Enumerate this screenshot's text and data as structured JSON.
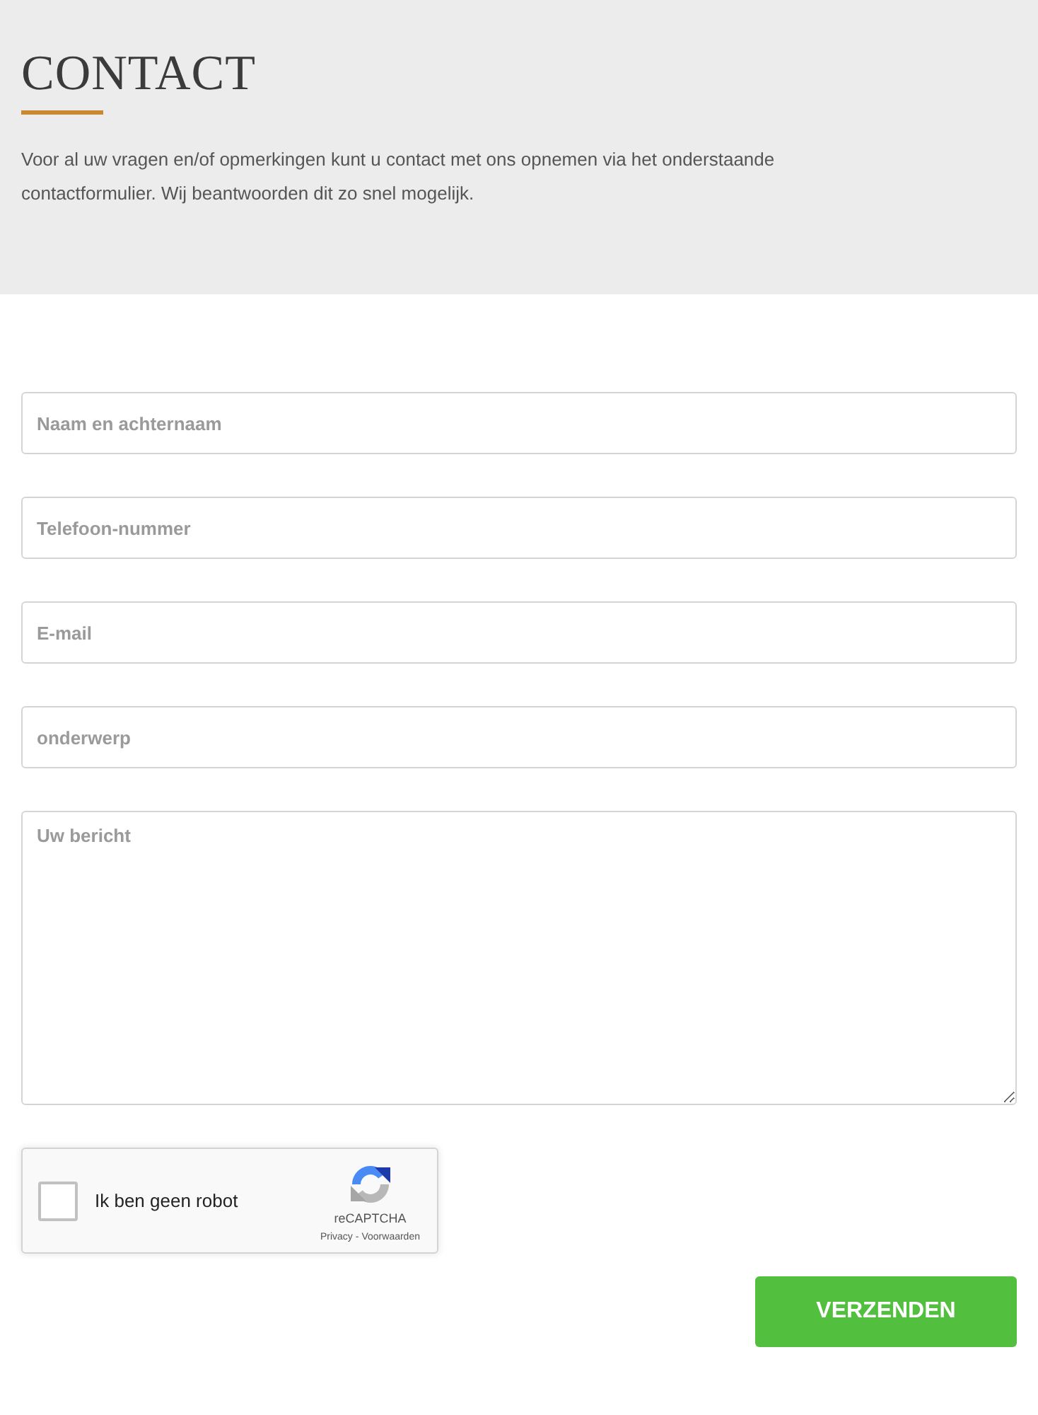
{
  "header": {
    "title": "CONTACT",
    "intro": "Voor al uw vragen en/of opmerkingen kunt u contact met ons opnemen via het onderstaande contactformulier. Wij beantwoorden dit zo snel mogelijk."
  },
  "form": {
    "fields": [
      {
        "kind": "input",
        "placeholder": "Naam en achternaam"
      },
      {
        "kind": "input",
        "placeholder": "Telefoon-nummer"
      },
      {
        "kind": "input",
        "placeholder": "E-mail"
      },
      {
        "kind": "input",
        "placeholder": "onderwerp"
      },
      {
        "kind": "textarea",
        "placeholder": "Uw bericht"
      }
    ],
    "captcha": {
      "checked": false,
      "label": "Ik ben geen robot",
      "brand": "reCAPTCHA",
      "privacy_link": "Privacy",
      "separator": "-",
      "terms_link": "Voorwaarden"
    },
    "submit": "VERZENDEN"
  }
}
